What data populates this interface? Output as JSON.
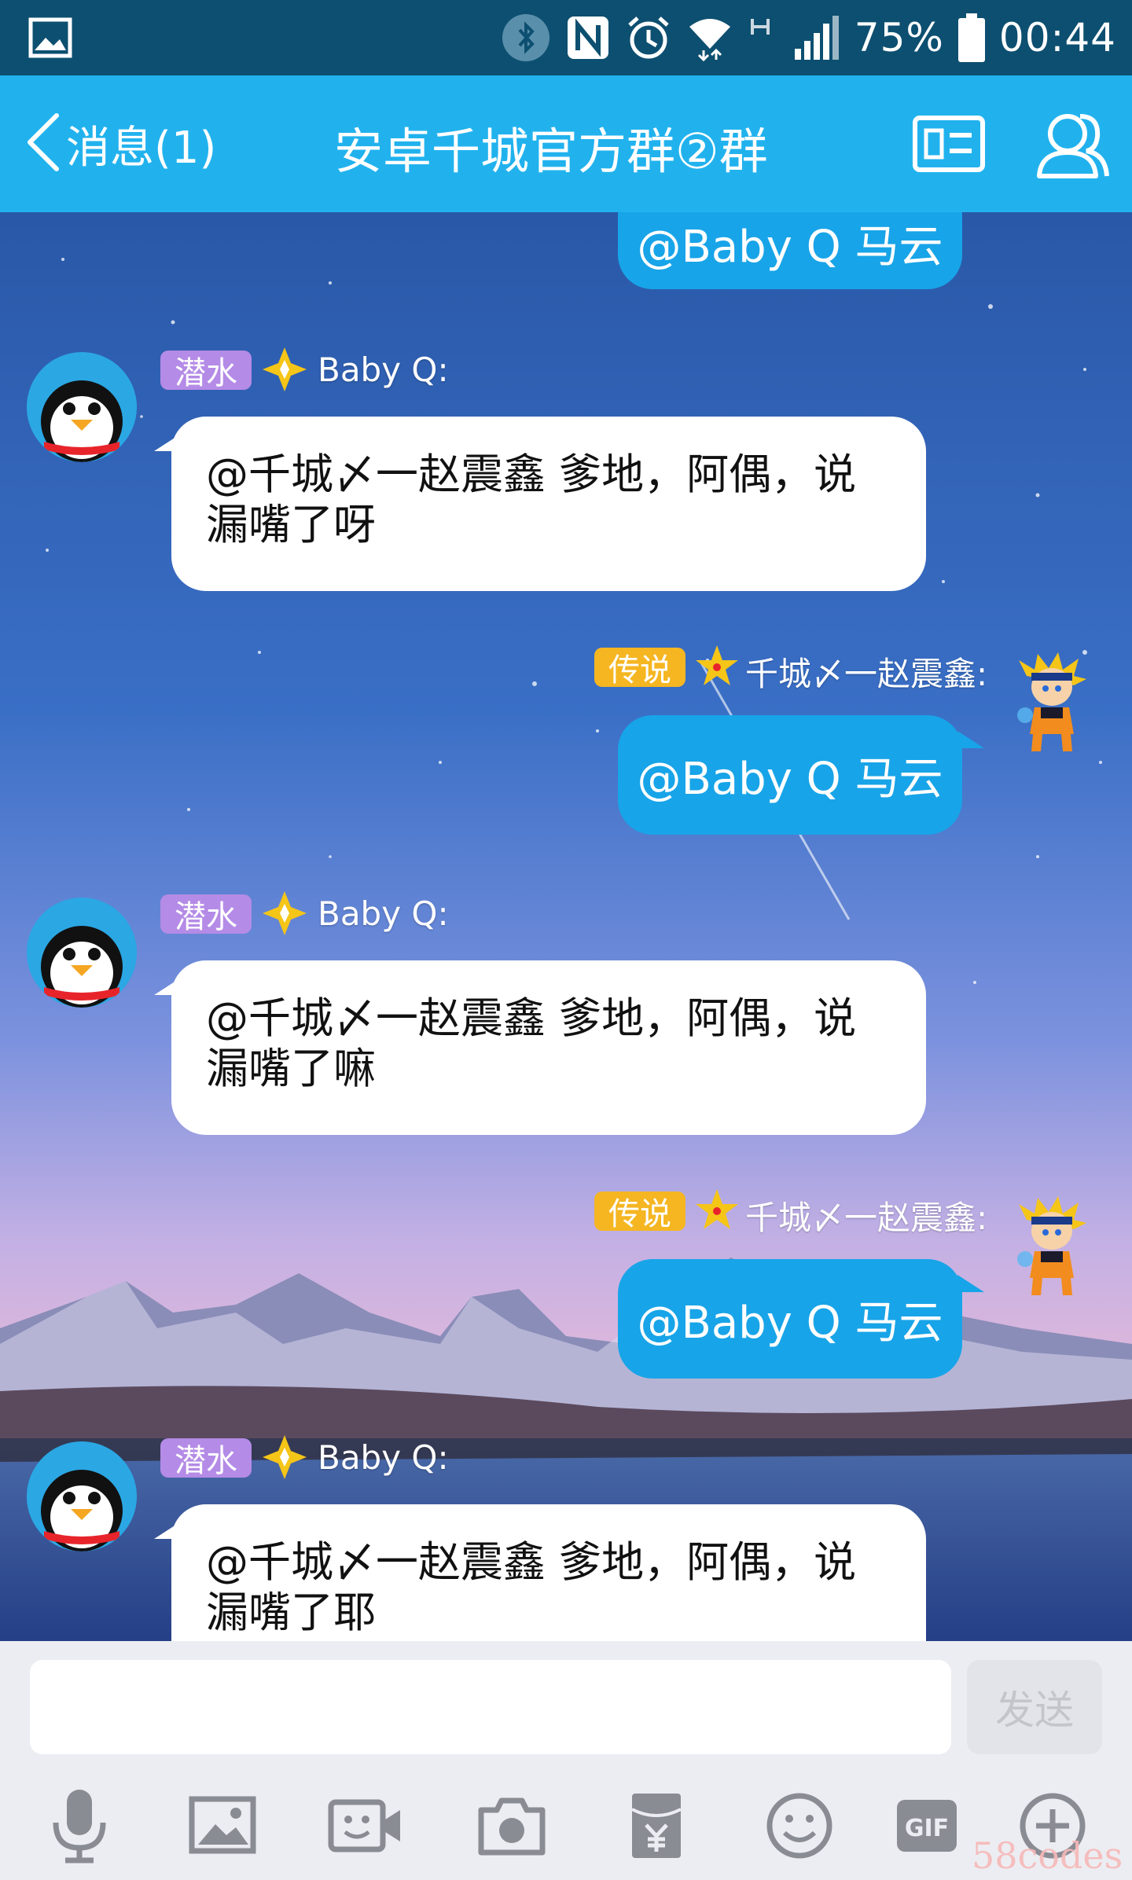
{
  "status_bar": {
    "battery": "75%",
    "time": "00:44",
    "icons": [
      "image-icon",
      "bluetooth-icon",
      "nfc-icon",
      "alarm-icon",
      "wifi-icon",
      "hplus-icon",
      "signal-icon",
      "battery-icon"
    ]
  },
  "header": {
    "back_label": "消息(1)",
    "title": "安卓千城官方群②群",
    "icons": [
      "chevron-left-icon",
      "group-card-icon",
      "members-icon"
    ],
    "accent_color": "#21b2ee"
  },
  "messages": [
    {
      "side": "out",
      "text": "@Baby Q 马云"
    },
    {
      "side": "in",
      "badge": "潜水",
      "sender": "Baby Q:",
      "text_line1": "@千城〆一赵震鑫 爹地，阿偶，说",
      "text_line2": "漏嘴了呀"
    },
    {
      "side": "out",
      "badge": "传说",
      "sender": "千城〆一赵震鑫:",
      "text": "@Baby Q 马云"
    },
    {
      "side": "in",
      "badge": "潜水",
      "sender": "Baby Q:",
      "text_line1": "@千城〆一赵震鑫 爹地，阿偶，说",
      "text_line2": "漏嘴了嘛"
    },
    {
      "side": "out",
      "badge": "传说",
      "sender": "千城〆一赵震鑫:",
      "text": "@Baby Q 马云"
    },
    {
      "side": "in",
      "badge": "潜水",
      "sender": "Baby Q:",
      "text_line1": "@千城〆一赵震鑫 爹地，阿偶，说",
      "text_line2": "漏嘴了耶"
    }
  ],
  "input": {
    "value": "",
    "placeholder": "",
    "send_label": "发送"
  },
  "toolbar": {
    "icons": [
      "microphone-icon",
      "picture-icon",
      "video-call-icon",
      "camera-icon",
      "red-packet-icon",
      "emoji-icon",
      "gif-icon",
      "plus-icon"
    ],
    "gif_label": "GIF"
  },
  "watermark": "58codes"
}
